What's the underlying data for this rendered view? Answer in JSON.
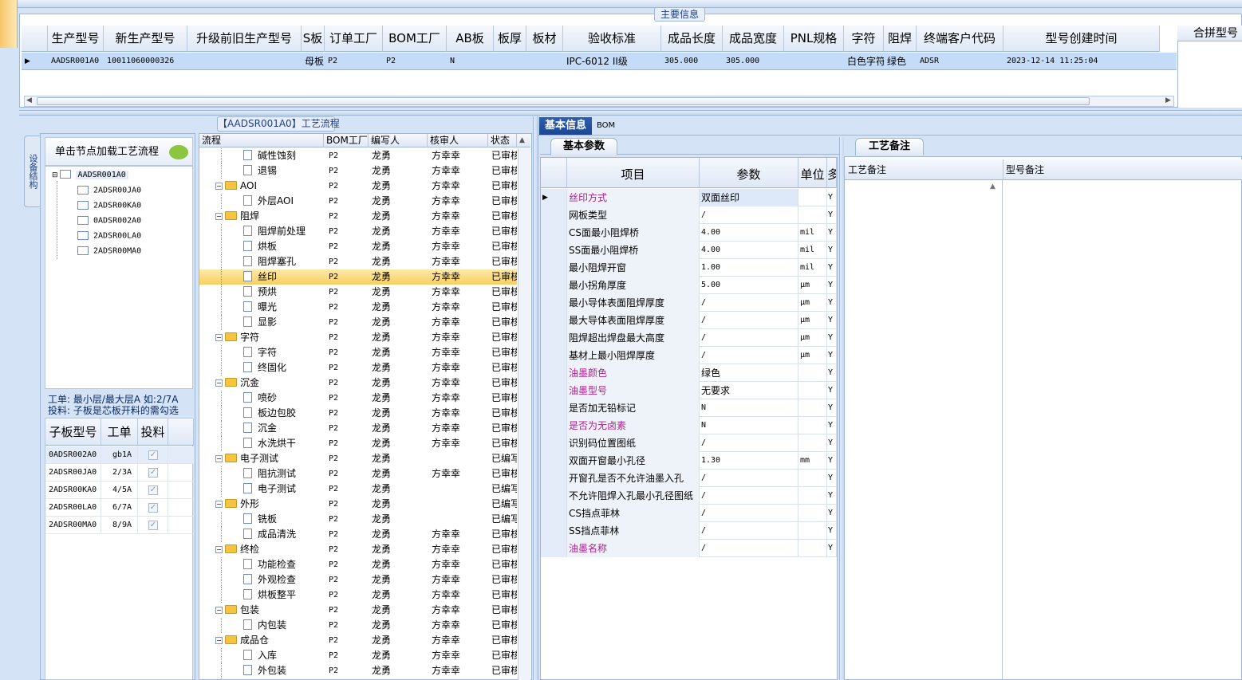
{
  "main_info": {
    "title": "主要信息",
    "columns": [
      "生产型号",
      "新生产型号",
      "升级前旧生产型号",
      "S板",
      "订单工厂",
      "BOM工厂",
      "AB板",
      "板厚",
      "板材",
      "验收标准",
      "成品长度",
      "成品宽度",
      "PNL规格",
      "字符",
      "阻焊",
      "终端客户代码",
      "型号创建时间"
    ],
    "row": [
      "AADSR001A0",
      "10011060000326",
      "",
      "母板",
      "P2",
      "P2",
      "N",
      "",
      "",
      "IPC-6012 II级",
      "305.000",
      "305.000",
      "",
      "白色字符",
      "绿色",
      "ADSR",
      "2023-12-14 11:25:04"
    ],
    "right_header": "合拼型号"
  },
  "left": {
    "side_tab": "设备结构",
    "load_label": "单击节点加载工艺流程",
    "tree_root": "AADSR001A0",
    "tree_children": [
      "2ADSR00JA0",
      "2ADSR00KA0",
      "0ADSR002A0",
      "2ADSR00LA0",
      "2ADSR00MA0"
    ],
    "info_line1": "工单: 最小层/最大层A 如:2/7A",
    "info_line2": "投料: 子板是芯板开料的需勾选",
    "sub_columns": [
      "子板型号",
      "工单",
      "投料"
    ],
    "sub_rows": [
      {
        "model": "0ADSR002A0",
        "order": "gb1A"
      },
      {
        "model": "2ADSR00JA0",
        "order": "2/3A"
      },
      {
        "model": "2ADSR00KA0",
        "order": "4/5A"
      },
      {
        "model": "2ADSR00LA0",
        "order": "6/7A"
      },
      {
        "model": "2ADSR00MA0",
        "order": "8/9A"
      }
    ],
    "checkmark": "✓"
  },
  "process": {
    "title": "【AADSR001A0】工艺流程",
    "columns": [
      "流程",
      "BOM工厂",
      "编写人",
      "核审人",
      "状态"
    ],
    "rows": [
      {
        "name": "碱性蚀刻",
        "group": false,
        "bom": "P2",
        "writer": "龙勇",
        "reviewer": "方幸幸",
        "status": "已审核"
      },
      {
        "name": "退锡",
        "group": false,
        "bom": "P2",
        "writer": "龙勇",
        "reviewer": "方幸幸",
        "status": "已审核"
      },
      {
        "name": "AOI",
        "group": true,
        "bom": "P2",
        "writer": "龙勇",
        "reviewer": "方幸幸",
        "status": "已审核"
      },
      {
        "name": "外层AOI",
        "group": false,
        "bom": "P2",
        "writer": "龙勇",
        "reviewer": "方幸幸",
        "status": "已审核"
      },
      {
        "name": "阻焊",
        "group": true,
        "bom": "P2",
        "writer": "龙勇",
        "reviewer": "方幸幸",
        "status": "已审核"
      },
      {
        "name": "阻焊前处理",
        "group": false,
        "bom": "P2",
        "writer": "龙勇",
        "reviewer": "方幸幸",
        "status": "已审核"
      },
      {
        "name": "烘板",
        "group": false,
        "bom": "P2",
        "writer": "龙勇",
        "reviewer": "方幸幸",
        "status": "已审核"
      },
      {
        "name": "阻焊塞孔",
        "group": false,
        "bom": "P2",
        "writer": "龙勇",
        "reviewer": "方幸幸",
        "status": "已审核"
      },
      {
        "name": "丝印",
        "group": false,
        "bom": "P2",
        "writer": "龙勇",
        "reviewer": "方幸幸",
        "status": "已审核",
        "selected": true
      },
      {
        "name": "预烘",
        "group": false,
        "bom": "P2",
        "writer": "龙勇",
        "reviewer": "方幸幸",
        "status": "已审核"
      },
      {
        "name": "曝光",
        "group": false,
        "bom": "P2",
        "writer": "龙勇",
        "reviewer": "方幸幸",
        "status": "已审核"
      },
      {
        "name": "显影",
        "group": false,
        "bom": "P2",
        "writer": "龙勇",
        "reviewer": "方幸幸",
        "status": "已审核"
      },
      {
        "name": "字符",
        "group": true,
        "bom": "P2",
        "writer": "龙勇",
        "reviewer": "方幸幸",
        "status": "已审核"
      },
      {
        "name": "字符",
        "group": false,
        "bom": "P2",
        "writer": "龙勇",
        "reviewer": "方幸幸",
        "status": "已审核"
      },
      {
        "name": "终固化",
        "group": false,
        "bom": "P2",
        "writer": "龙勇",
        "reviewer": "方幸幸",
        "status": "已审核"
      },
      {
        "name": "沉金",
        "group": true,
        "bom": "P2",
        "writer": "龙勇",
        "reviewer": "方幸幸",
        "status": "已审核"
      },
      {
        "name": "喷砂",
        "group": false,
        "bom": "P2",
        "writer": "龙勇",
        "reviewer": "方幸幸",
        "status": "已审核"
      },
      {
        "name": "板边包胶",
        "group": false,
        "bom": "P2",
        "writer": "龙勇",
        "reviewer": "方幸幸",
        "status": "已审核"
      },
      {
        "name": "沉金",
        "group": false,
        "bom": "P2",
        "writer": "龙勇",
        "reviewer": "方幸幸",
        "status": "已审核"
      },
      {
        "name": "水洗烘干",
        "group": false,
        "bom": "P2",
        "writer": "龙勇",
        "reviewer": "方幸幸",
        "status": "已审核"
      },
      {
        "name": "电子测试",
        "group": true,
        "bom": "P2",
        "writer": "龙勇",
        "reviewer": "",
        "status": "已编写"
      },
      {
        "name": "阻抗测试",
        "group": false,
        "bom": "P2",
        "writer": "龙勇",
        "reviewer": "方幸幸",
        "status": "已审核"
      },
      {
        "name": "电子测试",
        "group": false,
        "bom": "P2",
        "writer": "龙勇",
        "reviewer": "",
        "status": "已编写"
      },
      {
        "name": "外形",
        "group": true,
        "bom": "P2",
        "writer": "龙勇",
        "reviewer": "",
        "status": "已编写"
      },
      {
        "name": "铣板",
        "group": false,
        "bom": "P2",
        "writer": "龙勇",
        "reviewer": "",
        "status": "已编写"
      },
      {
        "name": "成品清洗",
        "group": false,
        "bom": "P2",
        "writer": "龙勇",
        "reviewer": "方幸幸",
        "status": "已审核"
      },
      {
        "name": "终检",
        "group": true,
        "bom": "P2",
        "writer": "龙勇",
        "reviewer": "方幸幸",
        "status": "已审核"
      },
      {
        "name": "功能检查",
        "group": false,
        "bom": "P2",
        "writer": "龙勇",
        "reviewer": "方幸幸",
        "status": "已审核"
      },
      {
        "name": "外观检查",
        "group": false,
        "bom": "P2",
        "writer": "龙勇",
        "reviewer": "方幸幸",
        "status": "已审核"
      },
      {
        "name": "烘板整平",
        "group": false,
        "bom": "P2",
        "writer": "龙勇",
        "reviewer": "方幸幸",
        "status": "已审核"
      },
      {
        "name": "包装",
        "group": true,
        "bom": "P2",
        "writer": "龙勇",
        "reviewer": "方幸幸",
        "status": "已审核"
      },
      {
        "name": "内包装",
        "group": false,
        "bom": "P2",
        "writer": "龙勇",
        "reviewer": "方幸幸",
        "status": "已审核"
      },
      {
        "name": "成品仓",
        "group": true,
        "bom": "P2",
        "writer": "龙勇",
        "reviewer": "方幸幸",
        "status": "已审核"
      },
      {
        "name": "入库",
        "group": false,
        "bom": "P2",
        "writer": "龙勇",
        "reviewer": "方幸幸",
        "status": "已审核"
      },
      {
        "name": "外包装",
        "group": false,
        "bom": "P2",
        "writer": "龙勇",
        "reviewer": "方幸幸",
        "status": "已审核"
      }
    ]
  },
  "tabs": {
    "basic": "基本信息",
    "bom": "BOM"
  },
  "params": {
    "subtab": "基本参数",
    "columns": [
      "项目",
      "参数",
      "单位",
      "多"
    ],
    "rows": [
      {
        "item": "丝印方式",
        "value": "双面丝印",
        "unit": "",
        "flag": "Y",
        "pink": true,
        "selected": true
      },
      {
        "item": "网板类型",
        "value": "/",
        "unit": "",
        "flag": "Y"
      },
      {
        "item": "CS面最小阻焊桥",
        "value": "4.00",
        "unit": "mil",
        "flag": "Y"
      },
      {
        "item": "SS面最小阻焊桥",
        "value": "4.00",
        "unit": "mil",
        "flag": "Y"
      },
      {
        "item": "最小阻焊开窗",
        "value": "1.00",
        "unit": "mil",
        "flag": "Y"
      },
      {
        "item": "最小拐角厚度",
        "value": "5.00",
        "unit": "μm",
        "flag": "Y"
      },
      {
        "item": "最小导体表面阻焊厚度",
        "value": "/",
        "unit": "μm",
        "flag": "Y"
      },
      {
        "item": "最大导体表面阻焊厚度",
        "value": "/",
        "unit": "μm",
        "flag": "Y"
      },
      {
        "item": "阻焊超出焊盘最大高度",
        "value": "/",
        "unit": "μm",
        "flag": "Y"
      },
      {
        "item": "基材上最小阻焊厚度",
        "value": "/",
        "unit": "μm",
        "flag": "Y"
      },
      {
        "item": "油墨颜色",
        "value": "绿色",
        "unit": "",
        "flag": "Y",
        "pink": true
      },
      {
        "item": "油墨型号",
        "value": "无要求",
        "unit": "",
        "flag": "Y",
        "pink": true
      },
      {
        "item": "是否加无铅标记",
        "value": "N",
        "unit": "",
        "flag": "Y"
      },
      {
        "item": "是否为无卤素",
        "value": "N",
        "unit": "",
        "flag": "Y",
        "pink": true
      },
      {
        "item": "识别码位置图纸",
        "value": "/",
        "unit": "",
        "flag": "Y"
      },
      {
        "item": "双面开窗最小孔径",
        "value": "1.30",
        "unit": "mm",
        "flag": "Y"
      },
      {
        "item": "开窗孔是否不允许油墨入孔",
        "value": "/",
        "unit": "",
        "flag": "Y"
      },
      {
        "item": "不允许阻焊入孔最小孔径图纸",
        "value": "/",
        "unit": "",
        "flag": "Y"
      },
      {
        "item": "CS挡点菲林",
        "value": "/",
        "unit": "",
        "flag": "Y"
      },
      {
        "item": "SS挡点菲林",
        "value": "/",
        "unit": "",
        "flag": "Y"
      },
      {
        "item": "油墨名称",
        "value": "/",
        "unit": "",
        "flag": "Y",
        "pink": true
      }
    ]
  },
  "remarks": {
    "subtab": "工艺备注",
    "col1": "工艺备注",
    "col2": "型号备注"
  },
  "colors": {
    "pink": "#b0208f",
    "accent": "#1d4690",
    "selected_row": "#c4dcf7"
  }
}
